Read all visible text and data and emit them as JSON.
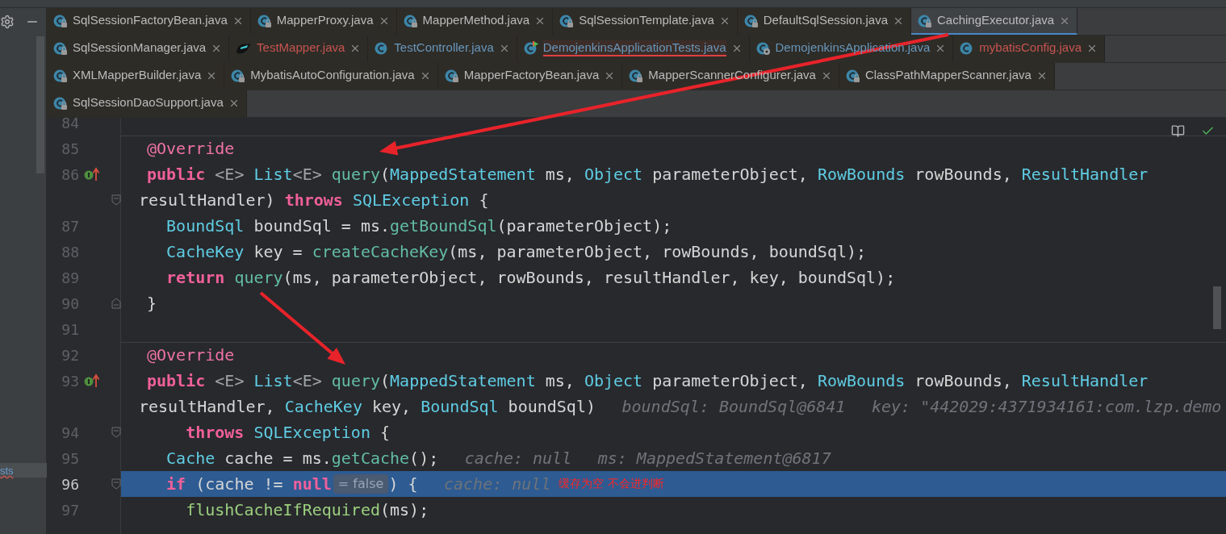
{
  "sidebar": {
    "items": [
      {
        "label": "sts",
        "selected": true
      }
    ]
  },
  "tab_rows": [
    [
      {
        "label": "SqlSessionFactoryBean.java",
        "kind": "locked",
        "color": "#bbbbbb",
        "error": false,
        "selected": false
      },
      {
        "label": "MapperProxy.java",
        "kind": "locked",
        "color": "#bbbbbb",
        "error": false,
        "selected": false
      },
      {
        "label": "MapperMethod.java",
        "kind": "locked",
        "color": "#bbbbbb",
        "error": false,
        "selected": false
      },
      {
        "label": "SqlSessionTemplate.java",
        "kind": "locked",
        "color": "#bbbbbb",
        "error": false,
        "selected": false
      },
      {
        "label": "DefaultSqlSession.java",
        "kind": "locked",
        "color": "#bbbbbb",
        "error": false,
        "selected": false
      },
      {
        "label": "CachingExecutor.java",
        "kind": "locked",
        "color": "#bbbbbb",
        "error": false,
        "selected": true
      }
    ],
    [
      {
        "label": "SqlSessionManager.java",
        "kind": "locked",
        "color": "#bbbbbb",
        "error": false,
        "selected": false
      },
      {
        "label": "TestMapper.java",
        "kind": "mapper",
        "color": "#c75450",
        "error": false,
        "selected": false
      },
      {
        "label": "TestController.java",
        "kind": "source",
        "color": "#6897bb",
        "error": false,
        "selected": false
      },
      {
        "label": "DemojenkinsApplicationTests.java",
        "kind": "test",
        "color": "#6897bb",
        "error": true,
        "selected": false
      },
      {
        "label": "DemojenkinsApplication.java",
        "kind": "boot",
        "color": "#6897bb",
        "error": false,
        "selected": false
      },
      {
        "label": "mybatisConfig.java",
        "kind": "source",
        "color": "#c75450",
        "error": false,
        "selected": false
      }
    ],
    [
      {
        "label": "XMLMapperBuilder.java",
        "kind": "locked",
        "color": "#bbbbbb",
        "error": false,
        "selected": false
      },
      {
        "label": "MybatisAutoConfiguration.java",
        "kind": "locked",
        "color": "#bbbbbb",
        "error": false,
        "selected": false
      },
      {
        "label": "MapperFactoryBean.java",
        "kind": "locked",
        "color": "#bbbbbb",
        "error": false,
        "selected": false
      },
      {
        "label": "MapperScannerConfigurer.java",
        "kind": "locked",
        "color": "#bbbbbb",
        "error": false,
        "selected": false
      },
      {
        "label": "ClassPathMapperScanner.java",
        "kind": "locked",
        "color": "#bbbbbb",
        "error": false,
        "selected": false
      }
    ],
    [
      {
        "label": "SqlSessionDaoSupport.java",
        "kind": "locked",
        "color": "#bbbbbb",
        "error": false,
        "selected": false
      }
    ]
  ],
  "editor": {
    "lines": [
      {
        "kind": "line",
        "number": "84",
        "selected": false,
        "separator": false,
        "overrides": false,
        "fold_start": false,
        "fold_end": false
      },
      {
        "kind": "line",
        "number": "85",
        "selected": false,
        "separator": true,
        "overrides": false,
        "fold_start": false,
        "fold_end": false,
        "tokens": [
          {
            "kind": "annotation",
            "text": "@Override"
          }
        ]
      },
      {
        "kind": "line",
        "number": "86",
        "selected": false,
        "separator": false,
        "overrides": true,
        "fold_start": false,
        "fold_end": false,
        "tokens": [
          {
            "kind": "keyword",
            "text": "public "
          },
          {
            "kind": "generic",
            "text": "<E> "
          },
          {
            "kind": "type",
            "text": "List"
          },
          {
            "kind": "generic",
            "text": "<E> "
          },
          {
            "kind": "method",
            "text": "query"
          },
          {
            "kind": "plain",
            "text": "("
          },
          {
            "kind": "type",
            "text": "MappedStatement "
          },
          {
            "kind": "plain",
            "text": "ms, "
          },
          {
            "kind": "type",
            "text": "Object "
          },
          {
            "kind": "plain",
            "text": "parameterObject, "
          },
          {
            "kind": "type",
            "text": "RowBounds "
          },
          {
            "kind": "plain",
            "text": "rowBounds, "
          },
          {
            "kind": "type",
            "text": "ResultHandler"
          }
        ]
      },
      {
        "kind": "continuation",
        "selected": false,
        "separator": false,
        "overrides": false,
        "fold_start": true,
        "fold_end": false,
        "tokens": [
          {
            "kind": "plain",
            "text": "resultHandler) "
          },
          {
            "kind": "keyword",
            "text": "throws "
          },
          {
            "kind": "type",
            "text": "SQLException "
          },
          {
            "kind": "plain",
            "text": "{"
          }
        ]
      },
      {
        "kind": "line",
        "number": "87",
        "selected": false,
        "separator": false,
        "overrides": false,
        "fold_start": false,
        "fold_end": false,
        "tokens": [
          {
            "kind": "type",
            "text": "  BoundSql "
          },
          {
            "kind": "plain",
            "text": "boundSql = ms."
          },
          {
            "kind": "method",
            "text": "getBoundSql"
          },
          {
            "kind": "plain",
            "text": "(parameterObject);"
          }
        ]
      },
      {
        "kind": "line",
        "number": "88",
        "selected": false,
        "separator": false,
        "overrides": false,
        "fold_start": false,
        "fold_end": false,
        "tokens": [
          {
            "kind": "type",
            "text": "  CacheKey "
          },
          {
            "kind": "plain",
            "text": "key = "
          },
          {
            "kind": "method",
            "text": "createCacheKey"
          },
          {
            "kind": "plain",
            "text": "(ms, parameterObject, rowBounds, boundSql);"
          }
        ]
      },
      {
        "kind": "line",
        "number": "89",
        "selected": false,
        "separator": false,
        "overrides": false,
        "fold_start": false,
        "fold_end": false,
        "tokens": [
          {
            "kind": "keyword",
            "text": "  return "
          },
          {
            "kind": "method",
            "text": "query"
          },
          {
            "kind": "plain",
            "text": "(ms, parameterObject, rowBounds, resultHandler, key, boundSql);"
          }
        ]
      },
      {
        "kind": "line",
        "number": "90",
        "selected": false,
        "separator": false,
        "overrides": false,
        "fold_start": false,
        "fold_end": true,
        "tokens": [
          {
            "kind": "plain",
            "text": "}"
          }
        ]
      },
      {
        "kind": "line",
        "number": "91",
        "selected": false,
        "separator": false,
        "overrides": false,
        "fold_start": false,
        "fold_end": false
      },
      {
        "kind": "line",
        "number": "92",
        "selected": false,
        "separator": true,
        "overrides": false,
        "fold_start": false,
        "fold_end": false,
        "tokens": [
          {
            "kind": "annotation",
            "text": "@Override"
          }
        ]
      },
      {
        "kind": "line",
        "number": "93",
        "selected": false,
        "separator": false,
        "overrides": true,
        "fold_start": false,
        "fold_end": false,
        "tokens": [
          {
            "kind": "keyword",
            "text": "public "
          },
          {
            "kind": "generic",
            "text": "<E> "
          },
          {
            "kind": "type",
            "text": "List"
          },
          {
            "kind": "generic",
            "text": "<E> "
          },
          {
            "kind": "method",
            "text": "query"
          },
          {
            "kind": "plain",
            "text": "("
          },
          {
            "kind": "type",
            "text": "MappedStatement "
          },
          {
            "kind": "plain",
            "text": "ms, "
          },
          {
            "kind": "type",
            "text": "Object "
          },
          {
            "kind": "plain",
            "text": "parameterObject, "
          },
          {
            "kind": "type",
            "text": "RowBounds "
          },
          {
            "kind": "plain",
            "text": "rowBounds, "
          },
          {
            "kind": "type",
            "text": "ResultHandler"
          }
        ]
      },
      {
        "kind": "continuation",
        "selected": false,
        "separator": false,
        "overrides": false,
        "fold_start": false,
        "fold_end": false,
        "tokens": [
          {
            "kind": "plain",
            "text": "resultHandler, "
          },
          {
            "kind": "type",
            "text": "CacheKey "
          },
          {
            "kind": "plain",
            "text": "key, "
          },
          {
            "kind": "type",
            "text": "BoundSql "
          },
          {
            "kind": "plain",
            "text": "boundSql)"
          },
          {
            "kind": "hint",
            "text": "boundSql: BoundSql@6841"
          },
          {
            "kind": "hint",
            "text": "key: \"442029:4371934161:com.lzp.demo"
          }
        ]
      },
      {
        "kind": "line",
        "number": "94",
        "selected": false,
        "separator": false,
        "overrides": false,
        "fold_start": true,
        "fold_end": false,
        "tokens": [
          {
            "kind": "keyword",
            "text": "    throws "
          },
          {
            "kind": "type",
            "text": "SQLException "
          },
          {
            "kind": "plain",
            "text": "{"
          }
        ]
      },
      {
        "kind": "line",
        "number": "95",
        "selected": false,
        "separator": false,
        "overrides": false,
        "fold_start": false,
        "fold_end": false,
        "tokens": [
          {
            "kind": "type",
            "text": "  Cache "
          },
          {
            "kind": "plain",
            "text": "cache = ms."
          },
          {
            "kind": "method",
            "text": "getCache"
          },
          {
            "kind": "plain",
            "text": "();"
          },
          {
            "kind": "hint",
            "text": "cache: null"
          },
          {
            "kind": "hint",
            "text": "ms: MappedStatement@6817"
          }
        ]
      },
      {
        "kind": "line",
        "number": "96",
        "selected": true,
        "separator": false,
        "overrides": false,
        "fold_start": true,
        "fold_end": false,
        "tokens": [
          {
            "kind": "keyword",
            "text": "  if "
          },
          {
            "kind": "plain",
            "text": "(cache != "
          },
          {
            "kind": "keyword",
            "text": "null"
          },
          {
            "kind": "inline_value",
            "text": "= false"
          },
          {
            "kind": "plain",
            "text": ") {"
          },
          {
            "kind": "hint",
            "text": "cache: null"
          },
          {
            "kind": "note",
            "text": "缓存为空 不会进判断"
          }
        ]
      },
      {
        "kind": "line",
        "number": "97",
        "selected": false,
        "separator": false,
        "overrides": false,
        "fold_start": false,
        "fold_end": false,
        "tokens": [
          {
            "kind": "call",
            "text": "    flushCacheIfRequired"
          },
          {
            "kind": "plain",
            "text": "(ms);"
          }
        ]
      }
    ]
  }
}
